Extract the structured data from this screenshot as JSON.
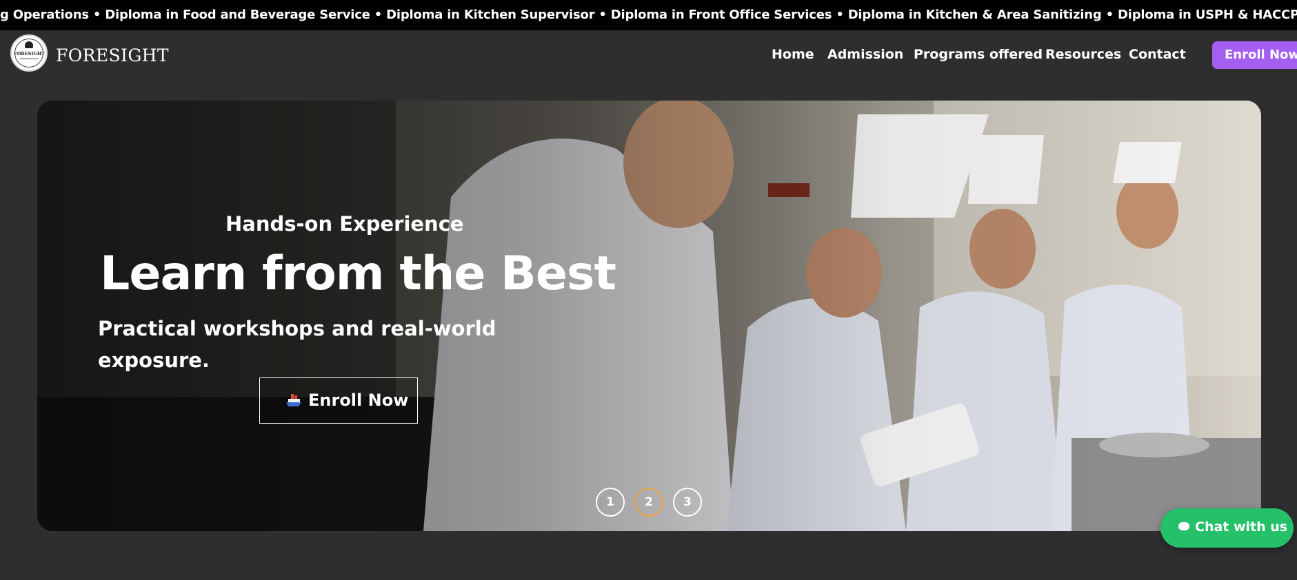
{
  "ticker": {
    "text": "g Operations • Diploma in Food and Beverage Service • Diploma in Kitchen Supervisor • Diploma in Front Office Services • Diploma in Kitchen & Area Sanitizing • Diploma in USPH & HACCP Compliance"
  },
  "header": {
    "logo_text": "FORESIGHT",
    "brand": "FORESIGHT",
    "nav": {
      "home": "Home",
      "admission": "Admission",
      "programs": "Programs offered",
      "resources": "Resources",
      "contact": "Contact"
    },
    "cta": "Enroll Now"
  },
  "hero": {
    "kicker": "Hands-on Experience",
    "title": "Learn from the Best",
    "subtitle": "Practical workshops and real-world exposure.",
    "cta": "Enroll Now",
    "cta_icon": "ship-icon",
    "slides": [
      "1",
      "2",
      "3"
    ],
    "active_slide": "2"
  },
  "chat": {
    "label": "Chat with us",
    "icon": "chat-bubble-icon"
  },
  "colors": {
    "background": "#2e2e2e",
    "ticker_bg": "#000000",
    "enroll_button": "#a45ef0",
    "active_dot": "#e9a23b",
    "chat_button": "#25c06a"
  }
}
